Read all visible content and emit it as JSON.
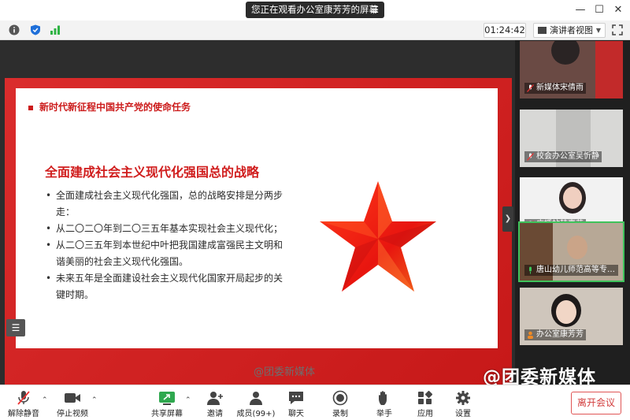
{
  "titlebar": {
    "sharing_text": "您正在观看办公室康芳芳的屏幕",
    "minimize": "—",
    "maximize": "☐",
    "close": "✕"
  },
  "infobar": {
    "timer": "01:24:42",
    "view_label": "演讲者视图",
    "view_caret": "▼"
  },
  "slide": {
    "header": "新时代新征程中国共产党的使命任务",
    "title": "全面建成社会主义现代化强国总的战略",
    "bullets": [
      "全面建成社会主义现代化强国，总的战略安排是分两步走：",
      "从二〇二〇年到二〇三五年基本实现社会主义现代化；",
      "从二〇三五年到本世纪中叶把我国建成富强民主文明和谐美丽的社会主义现代化强国。",
      "未来五年是全面建设社会主义现代化国家开局起步的关键时期。"
    ],
    "colors": {
      "frame": "#d71a1a",
      "title": "#d01d1d"
    }
  },
  "watermark": {
    "center": "@团委新媒体",
    "corner": "@团委新媒体"
  },
  "participants": [
    {
      "name": "新媒体宋倩雨"
    },
    {
      "name": "校会办公室吴忻静"
    },
    {
      "name": "广播站韩嘉莹"
    },
    {
      "name": "唐山幼儿师范高等专科..."
    },
    {
      "name": "办公室康芳芳"
    }
  ],
  "toolbar": {
    "mute": "解除静音",
    "video": "停止视频",
    "share": "共享屏幕",
    "invite": "邀请",
    "members": "成员(99+)",
    "chat": "聊天",
    "record": "录制",
    "raise_hand": "举手",
    "apps": "应用",
    "settings": "设置",
    "end": "离开会议"
  }
}
